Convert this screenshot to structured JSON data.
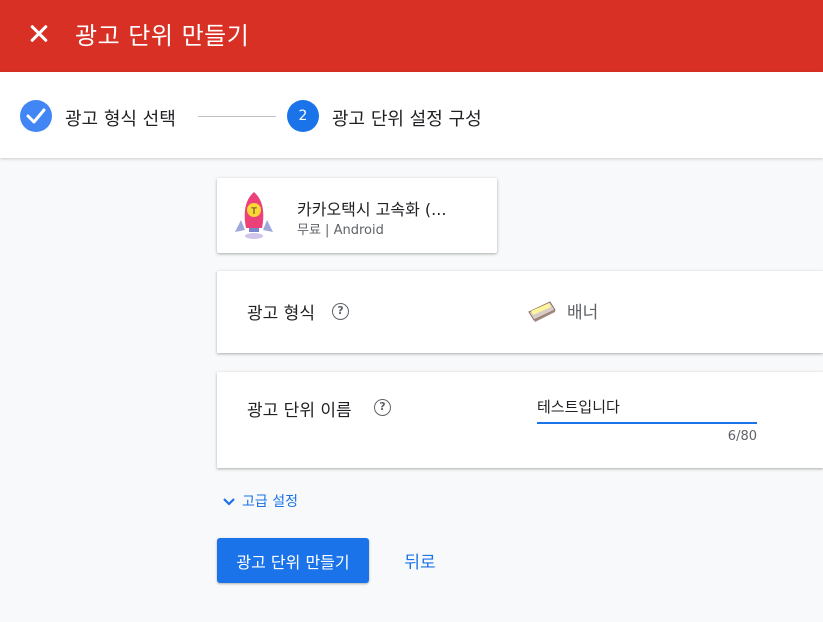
{
  "header": {
    "title": "광고 단위 만들기",
    "close_icon": "close-icon",
    "background_color": "#d93025"
  },
  "stepper": {
    "step1": {
      "label": "광고 형식 선택",
      "state": "completed",
      "icon": "check-icon"
    },
    "step2": {
      "number": "2",
      "label": "광고 단위 설정 구성",
      "state": "active"
    }
  },
  "app": {
    "icon": "rocket-app-icon",
    "name": "카카오택시 고속화 (...",
    "meta": "무료 | Android"
  },
  "format": {
    "label": "광고 형식",
    "help_icon": "help-icon",
    "value_icon": "banner-icon",
    "value": "배너"
  },
  "ad_unit_name": {
    "label": "광고 단위 이름",
    "help_icon": "help-icon",
    "value": "테스트입니다",
    "char_count": "6/80"
  },
  "advanced": {
    "icon": "chevron-down-icon",
    "label": "고급 설정"
  },
  "actions": {
    "create_label": "광고 단위 만들기",
    "back_label": "뒤로"
  },
  "colors": {
    "accent": "#1a73e8",
    "completed_step": "#4285f4"
  }
}
